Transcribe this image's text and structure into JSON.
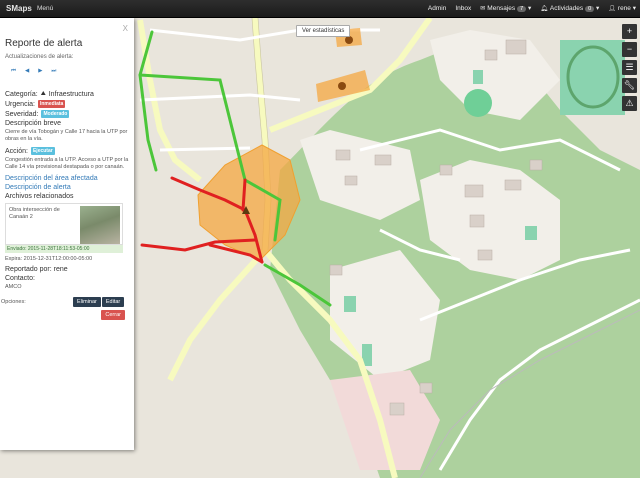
{
  "navbar": {
    "brand": "SMaps",
    "menu_label": "Menú",
    "admin_label": "Admin",
    "inbox_label": "Inbox",
    "messages_label": "Mensajes",
    "messages_count": "7",
    "activities_label": "Actividades",
    "activities_count": "0",
    "user_label": "rene"
  },
  "map": {
    "stats_button": "Ver estadísticas"
  },
  "panel": {
    "title": "Reporte de alerta",
    "subtitle": "Actualizaciones de alerta:",
    "pager": [
      "⏮",
      "◀",
      "▶",
      "⏭"
    ],
    "category_label": "Categoría:",
    "category_value": "Infraestructura",
    "urgency_label": "Urgencia:",
    "urgency_value": "Inmediata",
    "severity_label": "Severidad:",
    "severity_value": "Moderado",
    "brief_label": "Descripción breve",
    "brief_text": "Cierre de vía Tobogán y Calle 17 hacia la UTP por obras en la vía.",
    "action_label": "Acción:",
    "action_value": "Ejecutar",
    "action_text": "Congestión entrada a la UTP. Acceso a UTP por la Calle 14 vía provisional destapada o por canaán.",
    "area_link": "Descripción del área afectada",
    "alert_desc_link": "Descripción de alerta",
    "files_label": "Archivos relacionados",
    "file_name": "Obra intersección de Canaán 2",
    "sent": "Enviado: 2015-11-28T18:11:53-05:00",
    "expires": "Expira: 2015-12-31T12:00:00-05:00",
    "reported_label": "Reportado por: rene",
    "contact_label": "Contacto:",
    "contact_value": "AMCO",
    "options_label": "Opciones:",
    "delete_button": "Eliminar",
    "edit_button": "Editar",
    "close_button": "Cerrar"
  },
  "toolbar": {
    "icons": [
      "plus-icon",
      "minus-icon",
      "layers-icon",
      "wrench-icon",
      "warning-icon"
    ]
  },
  "colors": {
    "navbar": "#1b1b1b",
    "alert_area": "#f4a742",
    "road_closed": "#e02020",
    "road_open": "#4cc63a",
    "urgency_tag": "#d9534f",
    "severity_tag": "#5bc0de"
  }
}
